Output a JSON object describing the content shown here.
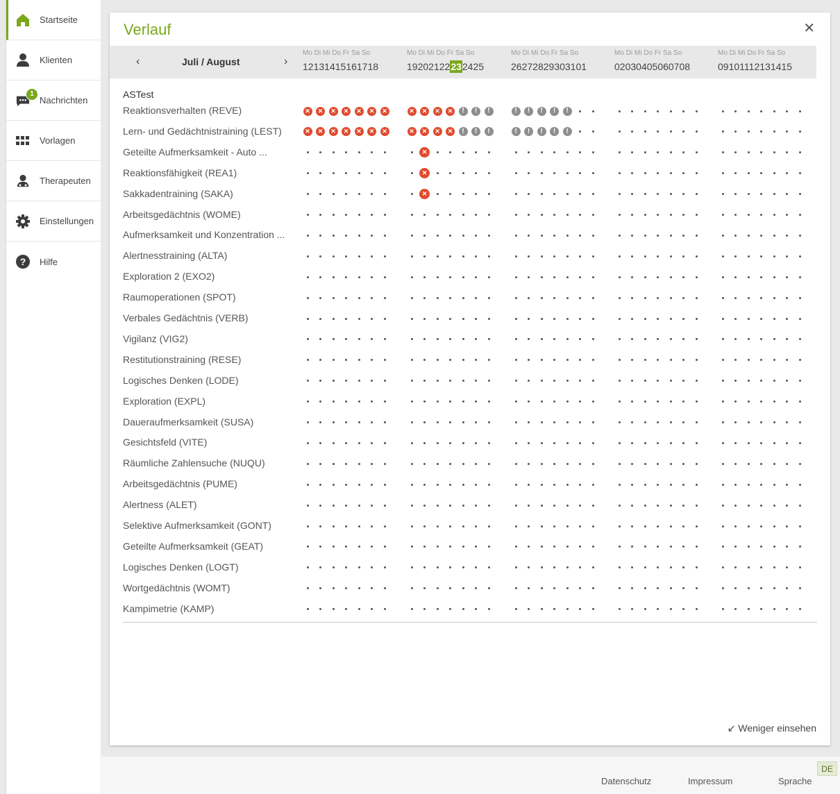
{
  "sidebar": {
    "items": [
      {
        "label": "Startseite",
        "icon": "home-icon",
        "active": true
      },
      {
        "label": "Klienten",
        "icon": "person-icon"
      },
      {
        "label": "Nachrichten",
        "icon": "chat-icon",
        "badge": "1"
      },
      {
        "label": "Vorlagen",
        "icon": "grid-icon"
      },
      {
        "label": "Therapeuten",
        "icon": "therapist-icon"
      },
      {
        "label": "Einstellungen",
        "icon": "gear-icon"
      },
      {
        "label": "Hilfe",
        "icon": "help-icon"
      }
    ]
  },
  "card": {
    "title": "Verlauf",
    "close_icon": "close-icon",
    "prev_icon": "chevron-left-icon",
    "next_icon": "chevron-right-icon",
    "month_label": "Juli / August",
    "weeks": [
      {
        "days": "Mo Di Mi Do Fr Sa So",
        "numbers": [
          "12",
          "13",
          "14",
          "15",
          "16",
          "17",
          "18"
        ]
      },
      {
        "days": "Mo Di Mi Do Fr Sa So",
        "numbers": [
          "19",
          "20",
          "21",
          "22",
          "23",
          "24",
          "25"
        ],
        "today_index": 4
      },
      {
        "days": "Mo Di Mi Do Fr Sa So",
        "numbers": [
          "26",
          "27",
          "28",
          "29",
          "30",
          "31",
          "01"
        ]
      },
      {
        "days": "Mo Di Mi Do Fr Sa So",
        "numbers": [
          "02",
          "03",
          "04",
          "05",
          "06",
          "07",
          "08"
        ]
      },
      {
        "days": "Mo Di Mi Do Fr Sa So",
        "numbers": [
          "09",
          "10",
          "11",
          "12",
          "13",
          "14",
          "15"
        ]
      }
    ],
    "group_label": "ASTest",
    "legend_icons": {
      "x": "error-icon",
      "warn": "warning-icon",
      "dot": "empty-day-dot"
    },
    "rows": [
      {
        "label": "Reaktionsverhalten (REVE)",
        "marks": "XXXXXXX|XXXXWWW|WWWWW..|.......|......."
      },
      {
        "label": "Lern- und Gedächtnistraining (LEST)",
        "marks": "XXXXXXX|XXXXWWW|WWWWW..|.......|......."
      },
      {
        "label": "Geteilte Aufmerksamkeit - Auto ...",
        "marks": ".......|.B.....|.......|.......|......."
      },
      {
        "label": "Reaktionsfähigkeit (REA1)",
        "marks": ".......|.B.....|.......|.......|......."
      },
      {
        "label": "Sakkadentraining (SAKA)",
        "marks": ".......|.B.....|.......|.......|......."
      },
      {
        "label": "Arbeitsgedächtnis (WOME)",
        "marks": ".......|.......|.......|.......|......."
      },
      {
        "label": "Aufmerksamkeit und Konzentration ...",
        "marks": ".......|.......|.......|.......|......."
      },
      {
        "label": "Alertnesstraining (ALTA)",
        "marks": ".......|.......|.......|.......|......."
      },
      {
        "label": "Exploration 2 (EXO2)",
        "marks": ".......|.......|.......|.......|......."
      },
      {
        "label": "Raumoperationen (SPOT)",
        "marks": ".......|.......|.......|.......|......."
      },
      {
        "label": "Verbales Gedächtnis (VERB)",
        "marks": ".......|.......|.......|.......|......."
      },
      {
        "label": "Vigilanz (VIG2)",
        "marks": ".......|.......|.......|.......|......."
      },
      {
        "label": "Restitutionstraining (RESE)",
        "marks": ".......|.......|.......|.......|......."
      },
      {
        "label": "Logisches Denken (LODE)",
        "marks": ".......|.......|.......|.......|......."
      },
      {
        "label": "Exploration (EXPL)",
        "marks": ".......|.......|.......|.......|......."
      },
      {
        "label": "Daueraufmerksamkeit (SUSA)",
        "marks": ".......|.......|.......|.......|......."
      },
      {
        "label": "Gesichtsfeld (VITE)",
        "marks": ".......|.......|.......|.......|......."
      },
      {
        "label": "Räumliche Zahlensuche (NUQU)",
        "marks": ".......|.......|.......|.......|......."
      },
      {
        "label": "Arbeitsgedächtnis (PUME)",
        "marks": ".......|.......|.......|.......|......."
      },
      {
        "label": "Alertness (ALET)",
        "marks": ".......|.......|.......|.......|......."
      },
      {
        "label": "Selektive Aufmerksamkeit (GONT)",
        "marks": ".......|.......|.......|.......|......."
      },
      {
        "label": "Geteilte Aufmerksamkeit (GEAT)",
        "marks": ".......|.......|.......|.......|......."
      },
      {
        "label": "Logisches Denken (LOGT)",
        "marks": ".......|.......|.......|.......|......."
      },
      {
        "label": "Wortgedächtnis (WOMT)",
        "marks": ".......|.......|.......|.......|......."
      },
      {
        "label": "Kampimetrie (KAMP)",
        "marks": ".......|.......|.......|.......|......."
      }
    ],
    "less_link": "Weniger einsehen",
    "less_icon": "arrow-down-left-icon"
  },
  "footer": {
    "privacy": "Datenschutz",
    "imprint": "Impressum",
    "language": "Sprache",
    "language_code": "DE"
  },
  "colors": {
    "accent": "#7aa81a",
    "error": "#e04b2e",
    "warning": "#8e8e8e"
  }
}
